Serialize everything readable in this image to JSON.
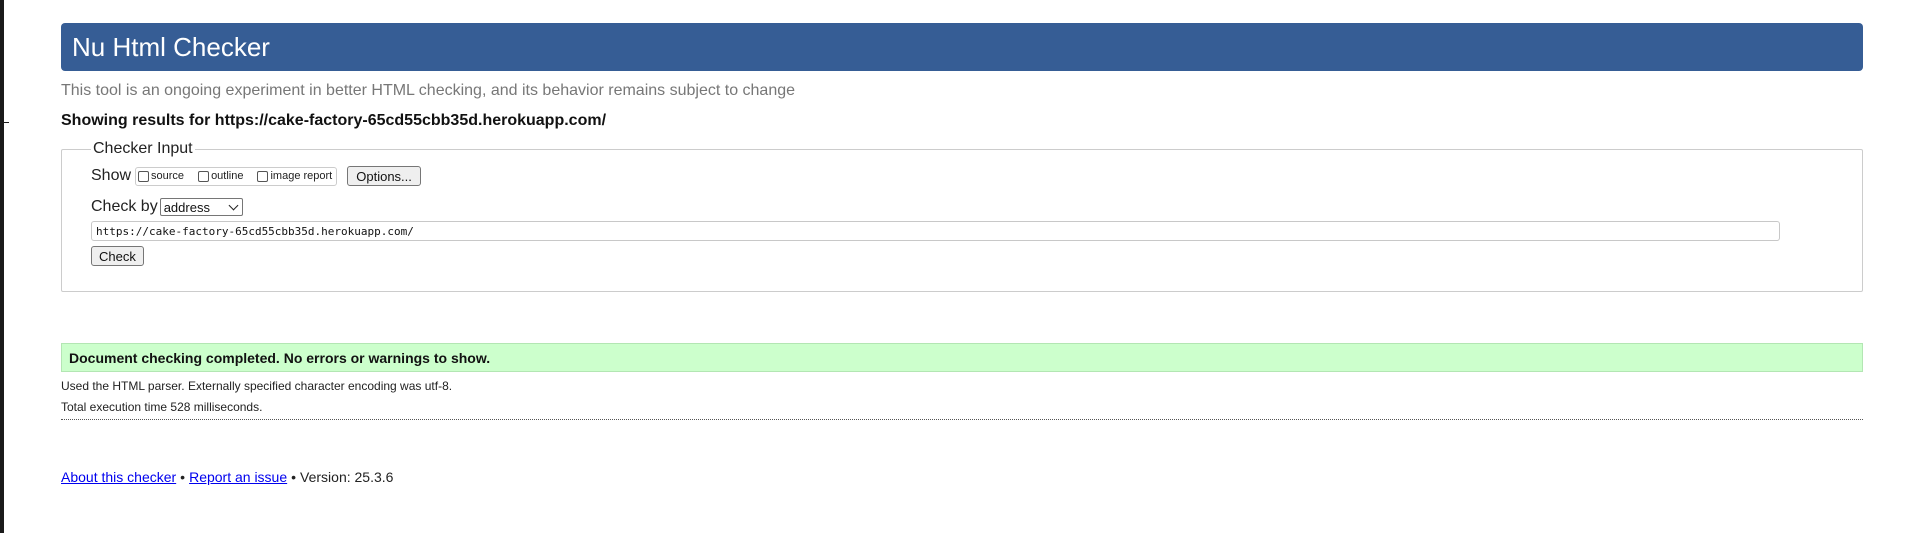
{
  "header": {
    "title": "Nu Html Checker",
    "accent_color": "#365d95"
  },
  "tagline": "This tool is an ongoing experiment in better HTML checking, and its behavior remains subject to change",
  "results_for": "Showing results for https://cake-factory-65cd55cbb35d.herokuapp.com/",
  "checker_input": {
    "legend": "Checker Input",
    "show_label": "Show",
    "show_options": [
      {
        "label": "source",
        "checked": false
      },
      {
        "label": "outline",
        "checked": false
      },
      {
        "label": "image report",
        "checked": false
      }
    ],
    "options_button": "Options...",
    "check_by_label": "Check by",
    "check_by_selected": "address",
    "url_value": "https://cake-factory-65cd55cbb35d.herokuapp.com/",
    "check_button": "Check"
  },
  "result": {
    "message": "Document checking completed. No errors or warnings to show.",
    "background_color": "#ccffcc",
    "parser_info": "Used the HTML parser. Externally specified character encoding was utf-8.",
    "execution_time": "Total execution time 528 milliseconds."
  },
  "footer": {
    "about_link": "About this checker",
    "separator": "•",
    "report_link": "Report an issue",
    "version": "Version: 25.3.6"
  }
}
